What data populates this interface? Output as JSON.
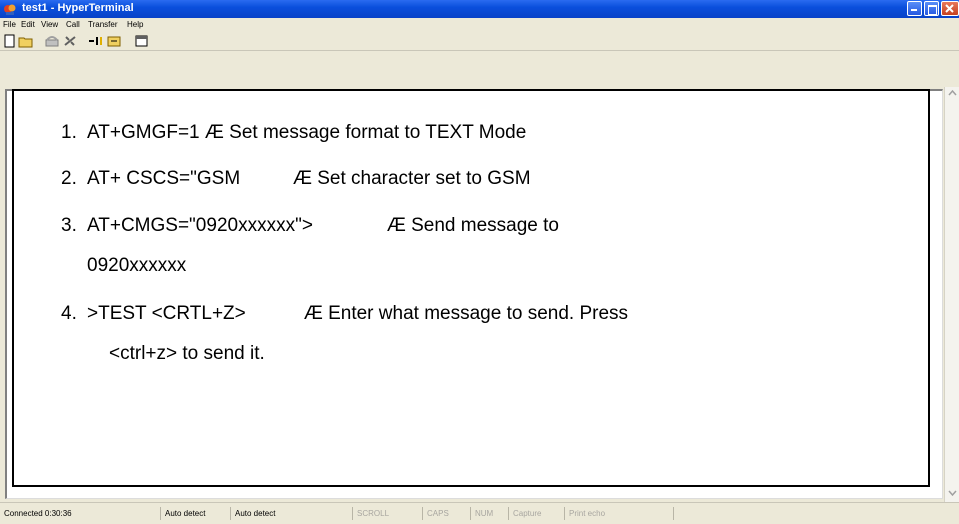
{
  "window": {
    "title": "test1 - HyperTerminal"
  },
  "menu": [
    "File",
    "Edit",
    "View",
    "Call",
    "Transfer",
    "Help"
  ],
  "toolbar": {
    "buttons": [
      "new-icon",
      "open-icon",
      "call-icon",
      "disconnect-icon",
      "send-icon",
      "receive-icon",
      "properties-icon"
    ]
  },
  "terminal": {
    "lines": [
      {
        "num": "1.",
        "text": "AT+GMGF=1 Æ Set message format to TEXT Mode"
      },
      {
        "num": "2.",
        "text": "AT+ CSCS=\"GSM          Æ Set character set to GSM"
      },
      {
        "num": "3.",
        "text": "AT+CMGS=\"0920xxxxxx\">              Æ Send message to"
      },
      {
        "num": "",
        "text": "0920xxxxxx"
      },
      {
        "num": "4.",
        "text": ">TEST <CRTL+Z>           Æ Enter what message to send. Press"
      },
      {
        "num": "",
        "text": "<ctrl+z> to send it."
      }
    ]
  },
  "status": {
    "connected": "Connected 0:30:36",
    "detect1": "Auto detect",
    "detect2": "Auto detect",
    "scroll": "SCROLL",
    "caps": "CAPS",
    "num": "NUM",
    "capture": "Capture",
    "print_echo": "Print echo"
  }
}
